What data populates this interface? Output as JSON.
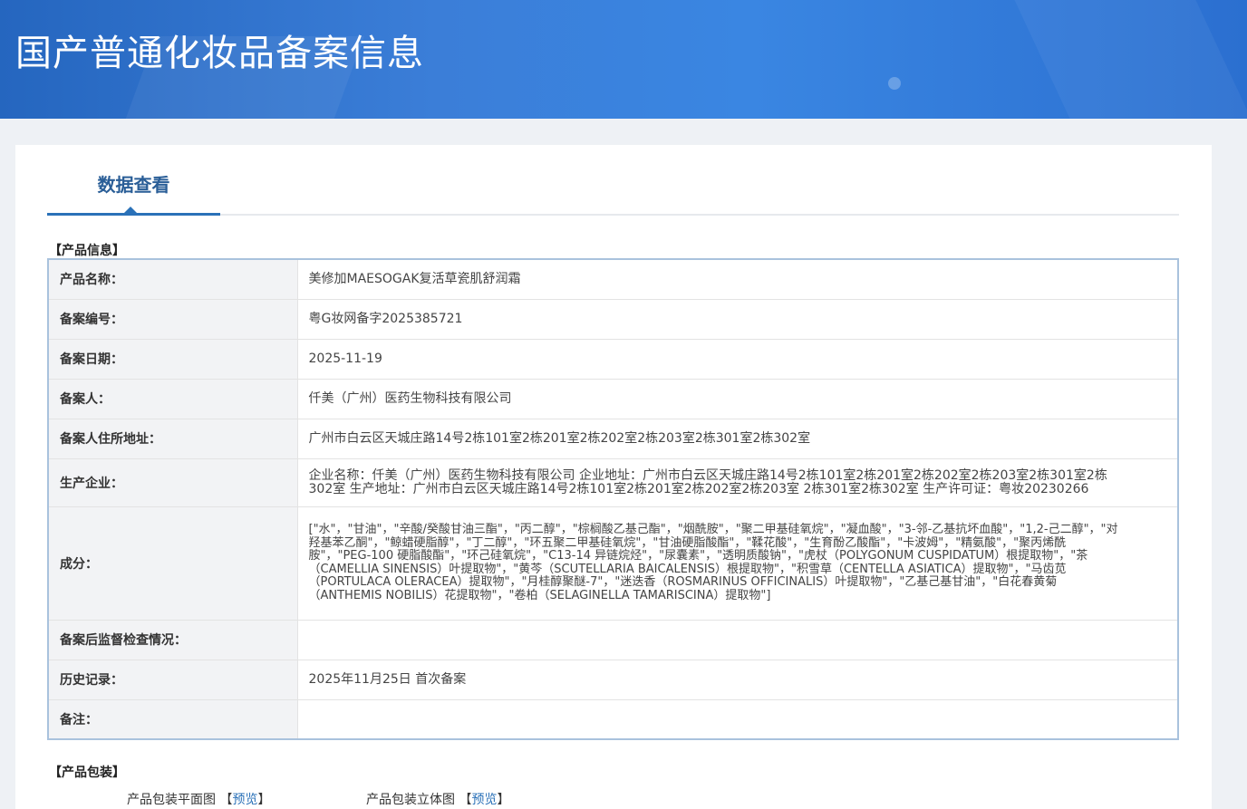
{
  "header": {
    "title": "国产普通化妆品备案信息"
  },
  "tabs": {
    "active": "数据查看"
  },
  "product_section_title": "【产品信息】",
  "fields": [
    {
      "label": "产品名称：",
      "value": "美修加MAESOGAK复活草瓷肌舒润霜"
    },
    {
      "label": "备案编号：",
      "value": "粤G妆网备字2025385721"
    },
    {
      "label": "备案日期：",
      "value": "2025-11-19"
    },
    {
      "label": "备案人：",
      "value": "仟美（广州）医药生物科技有限公司"
    },
    {
      "label": "备案人住所地址：",
      "value": "广州市白云区天城庄路14号2栋101室2栋201室2栋202室2栋203室2栋301室2栋302室"
    },
    {
      "label": "生产企业：",
      "value": "企业名称：仟美（广州）医药生物科技有限公司 企业地址：广州市白云区天城庄路14号2栋101室2栋201室2栋202室2栋203室2栋301室2栋302室 生产地址：广州市白云区天城庄路14号2栋101室2栋201室2栋202室2栋203室 2栋301室2栋302室 生产许可证：粤妆20230266"
    },
    {
      "label": "成分：",
      "value": "[\"水\"，\"甘油\"，\"辛酸/癸酸甘油三酯\"，\"丙二醇\"，\"棕榈酸乙基己酯\"，\"烟酰胺\"，\"聚二甲基硅氧烷\"，\"凝血酸\"，\"3-邻-乙基抗坏血酸\"，\"1,2-己二醇\"，\"对羟基苯乙酮\"，\"鲸蜡硬脂醇\"，\"丁二醇\"，\"环五聚二甲基硅氧烷\"，\"甘油硬脂酸酯\"，\"鞣花酸\"，\"生育酚乙酸酯\"，\"卡波姆\"，\"精氨酸\"，\"聚丙烯酰胺\"，\"PEG-100 硬脂酸酯\"，\"环己硅氧烷\"，\"C13-14 异链烷烃\"，\"尿囊素\"，\"透明质酸钠\"，\"虎杖（POLYGONUM CUSPIDATUM）根提取物\"，\"茶（CAMELLIA SINENSIS）叶提取物\"，\"黄芩（SCUTELLARIA BAICALENSIS）根提取物\"，\"积雪草（CENTELLA ASIATICA）提取物\"，\"马齿苋（PORTULACA OLERACEA）提取物\"，\"月桂醇聚醚-7\"，\"迷迭香（ROSMARINUS OFFICINALIS）叶提取物\"，\"乙基己基甘油\"，\"白花春黄菊（ANTHEMIS NOBILIS）花提取物\"，\"卷柏（SELAGINELLA TAMARISCINA）提取物\"]"
    },
    {
      "label": "备案后监督检查情况：",
      "value": ""
    },
    {
      "label": "历史记录：",
      "value": "2025年11月25日 首次备案"
    },
    {
      "label": "备注：",
      "value": ""
    }
  ],
  "package_section_title": "【产品包装】",
  "packaging": {
    "flat_label": "产品包装平面图",
    "solid_label": "产品包装立体图",
    "preview_link": "预览",
    "bracket_open": "【",
    "bracket_close": "】"
  }
}
